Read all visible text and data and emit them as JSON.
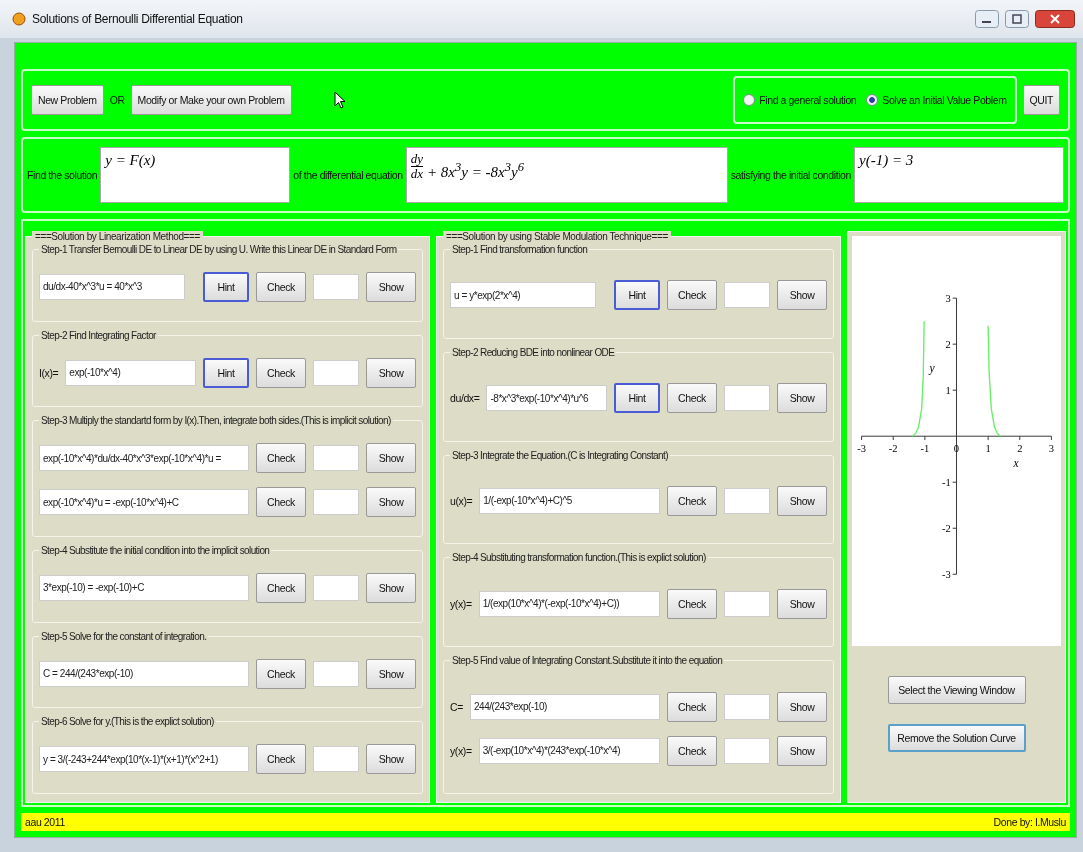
{
  "window": {
    "title": "Solutions of Bernoulli Differential Equation"
  },
  "toolbar": {
    "new_button": "New Problem",
    "or_label": "OR",
    "modify_button": "Modify or Make your own Problem",
    "modes": [
      {
        "label": "Find a general solution",
        "selected": false
      },
      {
        "label": "Solve an Initial Value Poblem",
        "selected": true
      }
    ],
    "quit_button": "QUIT"
  },
  "problem": {
    "find_label": "Find the solution",
    "solution": "y = F(x)",
    "equation_label": "of the differential equation",
    "equation_numerator": "dy",
    "equation_denominator": "dx",
    "equation_rest": "+ 8x$^{3}$y = -8x$^{3}$y$^{6}$",
    "condition_label": "satisfying the initial condition",
    "condition": "y(-1) = 3"
  },
  "panels": [
    {
      "title": "===Solution by Linearization Method===",
      "steps": [
        {
          "title": "Step-1 Transfer Bernoulli DE to Linear DE by using U. Write this Linear DE in Standard Form",
          "rows": [
            {
              "value": "du/dx-40*x^3*u = 40*x^3",
              "hint": "Hint",
              "check": "Check",
              "show": "Show"
            }
          ]
        },
        {
          "title": "Step-2 Find Integrating Factor",
          "rows": [
            {
              "prefix": "I(x)=",
              "value": "exp(-10*x^4)",
              "hint": "Hint",
              "check": "Check",
              "show": "Show"
            }
          ]
        },
        {
          "title": "Step-3 Multiply the standartd form by I(x).Then, integrate both sides.(This is implicit solution)",
          "rows": [
            {
              "value": "exp(-10*x^4)*du/dx-40*x^3*exp(-10*x^4)*u =",
              "check": "Check",
              "show": "Show"
            },
            {
              "value": "exp(-10*x^4)*u = -exp(-10*x^4)+C",
              "check": "Check",
              "show": "Show"
            }
          ]
        },
        {
          "title": "Step-4 Substitute the initial condition into the implicit solution",
          "rows": [
            {
              "value": "3*exp(-10) = -exp(-10)+C",
              "check": "Check",
              "show": "Show"
            }
          ]
        },
        {
          "title": "Step-5 Solve for the constant of integration.",
          "rows": [
            {
              "value": "C = 244/(243*exp(-10)",
              "check": "Check",
              "show": "Show"
            }
          ]
        },
        {
          "title": "Step-6 Solve for y.(This is the explict solution)",
          "rows": [
            {
              "value": "y = 3/(-243+244*exp(10*(x-1)*(x+1)*(x^2+1)",
              "check": "Check",
              "show": "Show"
            }
          ]
        }
      ]
    },
    {
      "title": "===Solution by using Stable Modulation Technique===",
      "steps": [
        {
          "title": "Step-1 Find transformation function",
          "rows": [
            {
              "value": "u = y*exp(2*x^4)",
              "hint": "Hint",
              "check": "Check",
              "show": "Show"
            }
          ]
        },
        {
          "title": "Step-2 Reducing BDE into nonlinear ODE",
          "rows": [
            {
              "prefix": "du/dx=",
              "value": "-8*x^3*exp(-10*x^4)*u^6",
              "hint": "Hint",
              "check": "Check",
              "show": "Show"
            }
          ]
        },
        {
          "title": "Step-3 Integrate the Equation.(C is Integrating Constant)",
          "rows": [
            {
              "prefix": "u(x)=",
              "value": "1/(-exp(-10*x^4)+C)^5",
              "check": "Check",
              "show": "Show"
            }
          ]
        },
        {
          "title": "Step-4 Substituting transformation function.(This is explict solution)",
          "rows": [
            {
              "prefix": "y(x)=",
              "value": "1/(exp(10*x^4)*(-exp(-10*x^4)+C))",
              "check": "Check",
              "show": "Show"
            }
          ]
        },
        {
          "title": "Step-5 Find value of Integrating Constant.Substitute it into the equation",
          "rows": [
            {
              "prefix": "C=",
              "value": "244/(243*exp(-10)",
              "check": "Check",
              "show": "Show"
            },
            {
              "prefix": "y(x)=",
              "value": "3/(-exp(10*x^4)*(243*exp(-10*x^4)",
              "check": "Check",
              "show": "Show"
            }
          ]
        }
      ]
    }
  ],
  "plot": {
    "chart_data": {
      "type": "line",
      "xlabel": "x",
      "ylabel": "y",
      "xlim": [
        -3,
        3
      ],
      "ylim": [
        -3,
        3
      ],
      "xticks": [
        -3,
        -2,
        -1,
        0,
        1,
        2,
        3
      ],
      "yticks": [
        -3,
        -2,
        -1,
        1,
        2,
        3
      ],
      "x": [
        -1.4,
        -1.3,
        -1.2,
        -1.1,
        -1.05,
        -1.02,
        null,
        1.0,
        1.03,
        1.1,
        1.2,
        1.3,
        1.4
      ],
      "series": [
        {
          "color": "#66ee66",
          "values": [
            0,
            0.05,
            0.2,
            0.6,
            1.3,
            2.5,
            null,
            2.4,
            1.4,
            0.6,
            0.2,
            0.05,
            0
          ]
        }
      ]
    },
    "view_button": "Select the Viewing Window",
    "remove_button": "Remove the Solution Curve"
  },
  "status_bar": {
    "left": "aau 2011",
    "right": "Done by: I.Muslu"
  }
}
